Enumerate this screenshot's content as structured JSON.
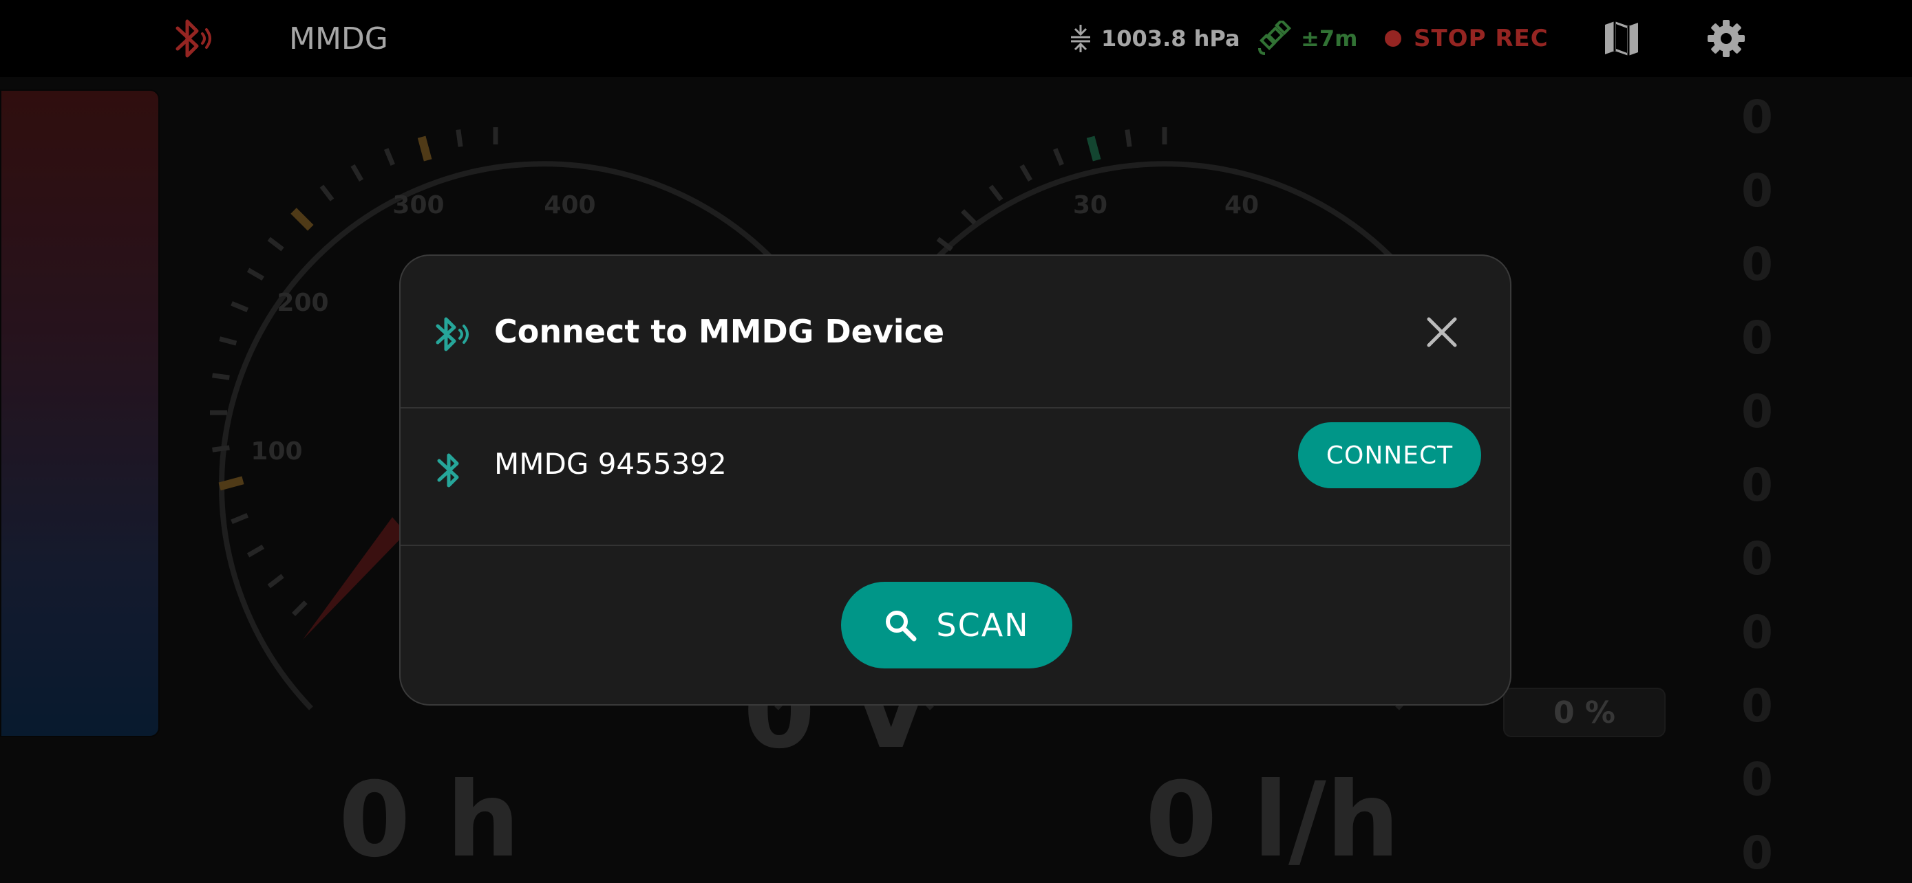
{
  "header": {
    "app_title": "MMDG",
    "pressure": "1003.8 hPa",
    "gps_accuracy": "±7m",
    "record_label": "STOP REC"
  },
  "gauges": {
    "left_ticks": [
      "100",
      "200",
      "300",
      "400"
    ],
    "right_ticks": [
      "30",
      "40"
    ],
    "hours_value": "0 h",
    "voltage_value": "0 V",
    "flow_value": "0 l/h",
    "percent_value": "0 %",
    "zero_column": [
      "0",
      "0",
      "0",
      "0",
      "0",
      "0",
      "0",
      "0",
      "0",
      "0",
      "0"
    ]
  },
  "dialog": {
    "title": "Connect to MMDG Device",
    "device_name": "MMDG 9455392",
    "connect_label": "CONNECT",
    "scan_label": "SCAN"
  },
  "colors": {
    "accent": "#009688",
    "record": "#e53935",
    "gps": "#4caf50"
  }
}
